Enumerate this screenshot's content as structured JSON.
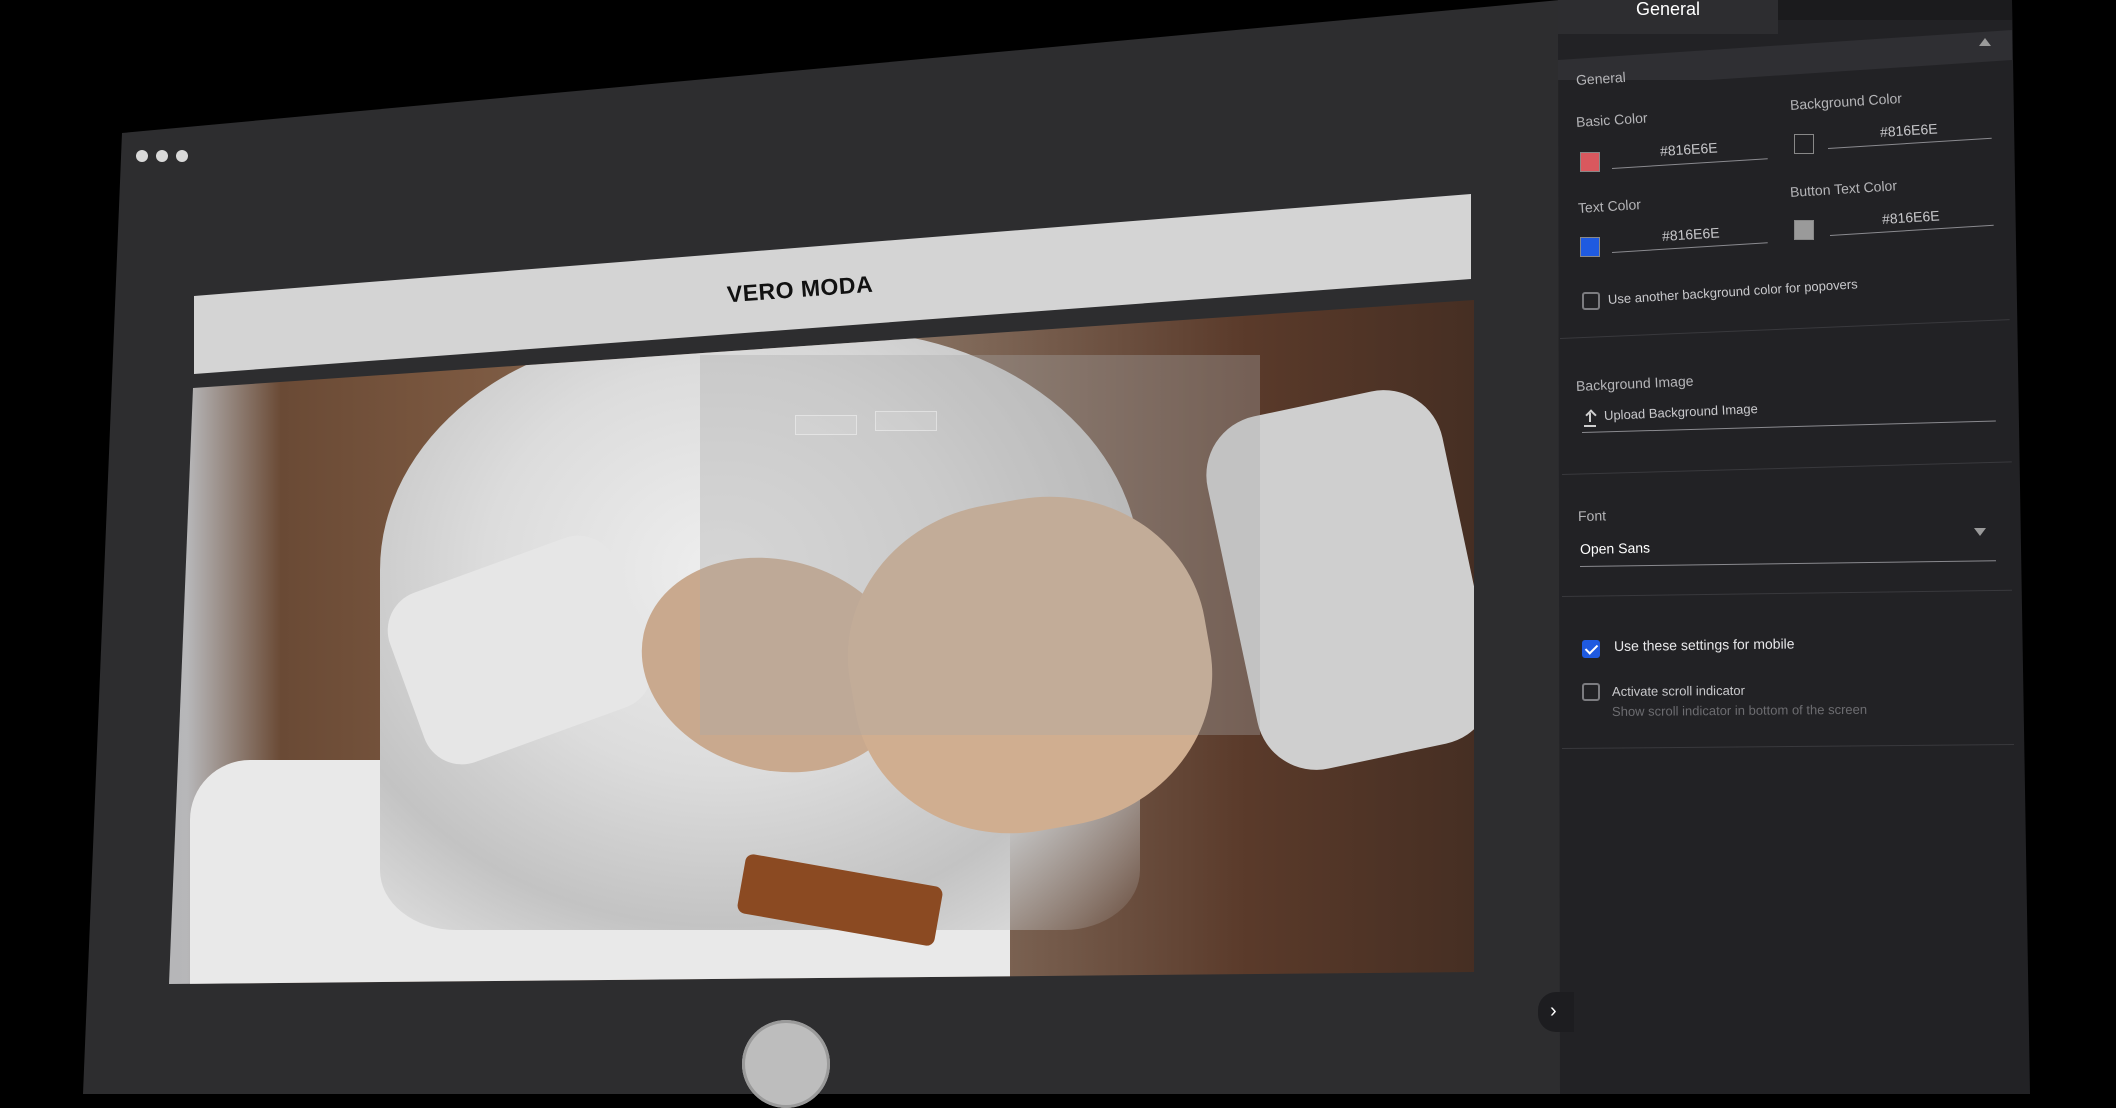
{
  "preview": {
    "brand_logo": "VERO MODA"
  },
  "panel": {
    "tabs": {
      "active": "General"
    },
    "section_title": "General",
    "colors": {
      "basic_color_label": "Basic Color",
      "basic_color_value": "#816E6E",
      "basic_color_swatch": "#d9585e",
      "background_color_label": "Background Color",
      "background_color_value": "#816E6E",
      "background_color_swatch": "transparent",
      "text_color_label": "Text Color",
      "text_color_value": "#816E6E",
      "text_color_swatch": "#1f5ae0",
      "button_text_color_label": "Button Text Color",
      "button_text_color_value": "#816E6E",
      "button_text_color_swatch": "#9a9a9a"
    },
    "popover_bg_label": "Use another background color for popovers",
    "background_image_label": "Background Image",
    "upload_label": "Upload Background Image",
    "font_label": "Font",
    "font_value": "Open Sans",
    "mobile_label": "Use these settings for mobile",
    "scroll_label": "Activate scroll indicator",
    "scroll_hint": "Show scroll indicator in bottom of the screen"
  },
  "icons": [
    "window-dots-icon",
    "collapse-chevron-icon",
    "upload-icon",
    "chevron-down-icon",
    "checkmark-icon",
    "chevron-right-icon"
  ]
}
